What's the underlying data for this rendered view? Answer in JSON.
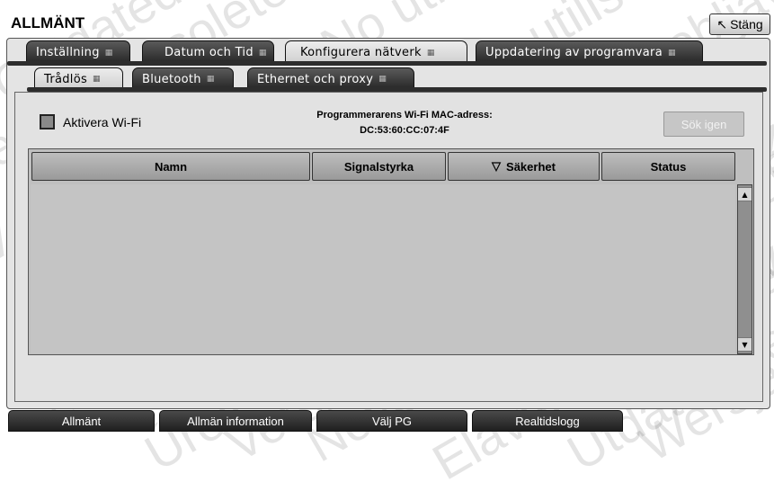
{
  "header": {
    "title": "ALLMÄNT",
    "close_label": "Stäng"
  },
  "tabs": [
    {
      "label": "Inställning",
      "active": false
    },
    {
      "label": "Datum och Tid",
      "active": false
    },
    {
      "label": "Konfigurera nätverk",
      "active": true
    },
    {
      "label": "Uppdatering av programvara",
      "active": false
    }
  ],
  "subtabs": [
    {
      "label": "Trådlös",
      "active": true
    },
    {
      "label": "Bluetooth",
      "active": false
    },
    {
      "label": "Ethernet och proxy",
      "active": false
    }
  ],
  "wifi": {
    "checkbox_label": "Aktivera Wi-Fi",
    "mac_title": "Programmerarens Wi-Fi MAC-adress:",
    "mac_value": "DC:53:60:CC:07:4F",
    "rescan_label": "Sök igen"
  },
  "table": {
    "columns": [
      "Namn",
      "Signalstyrka",
      "Säkerhet",
      "Status"
    ],
    "sorted_column": "Säkerhet",
    "rows": []
  },
  "bottom_nav": [
    "Allmänt",
    "Allmän information",
    "Välj PG",
    "Realtidslogg"
  ],
  "watermark": [
    "Outdated version. Do not use.",
    "Version obsolète. Ne pas utiliser.",
    "Versión obsoleta. No utilizar.",
    "Version périmée. Ne pas utiliser.",
    "Zastarjela verzija. Nemojte upotrebljavati.",
    "Úrelt útgáfa. Notið ekki.",
    "Versione obsoleta. Non utilizzare.",
    "Novecojusi versija. Neizmantot.",
    "Pasenusi versija. Nenaudokite.",
    "Elavult verzió. Ne használja!",
    "Verouderde versie. Niet gebruiken.",
    "Utdatert versjon. Skal ikke brukes.",
    "Wersja przeterminowana. Nie używać."
  ]
}
